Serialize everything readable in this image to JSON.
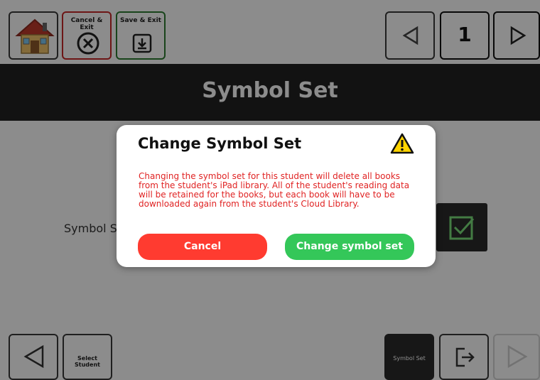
{
  "toolbar": {
    "cancel_exit_label": "Cancel & Exit",
    "save_exit_label": "Save & Exit",
    "page_number": "1"
  },
  "page": {
    "title": "Symbol Set"
  },
  "content": {
    "row_label": "Symbol Set"
  },
  "bottom": {
    "select_student_label": "Select Student",
    "symbol_set_label": "Symbol Set"
  },
  "dialog": {
    "title": "Change Symbol Set",
    "message": "Changing the symbol set for this student will delete all books from the student's iPad library. All of the student's reading data will be retained for the books, but each book will have to be downloaded again from the student's Cloud Library.",
    "cancel_label": "Cancel",
    "confirm_label": "Change symbol set"
  },
  "colors": {
    "danger": "#ff3b30",
    "success": "#34c759",
    "message": "#e02323",
    "header": "#222222",
    "cancel_outline": "#c62828",
    "save_outline": "#2e7d32",
    "warning_yellow": "#ffd400"
  },
  "icons": {
    "home": "home-icon",
    "cancel": "x-circle-icon",
    "save": "download-icon",
    "prev": "triangle-left-icon",
    "next": "triangle-right-icon",
    "check": "check-square-icon",
    "exit": "exit-icon",
    "warning": "warning-icon"
  }
}
